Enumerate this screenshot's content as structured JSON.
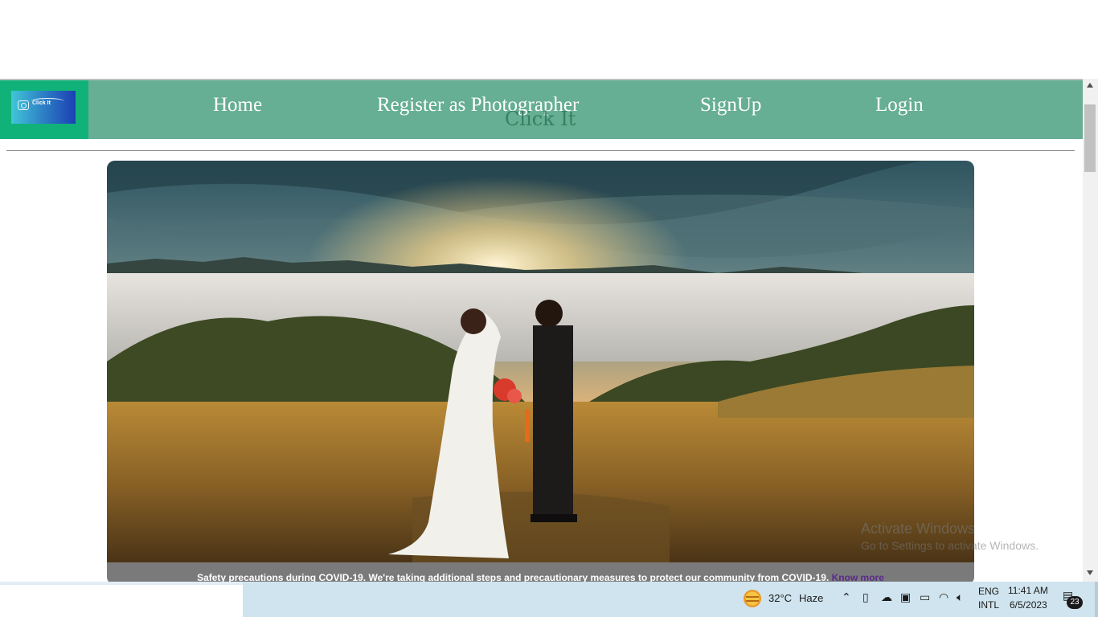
{
  "nav": {
    "logo_text": "Click It",
    "links": [
      "Home",
      "Register as Photographer",
      "SignUp",
      "Login"
    ]
  },
  "site_title": "Click It",
  "covid": {
    "message": "Safety precautions during COVID-19. We're taking additional steps and precautionary measures to protect our community from COVID-19.",
    "link": "Know more"
  },
  "watermark": {
    "line1": "Activate Windows",
    "line2": "Go to Settings to activate Windows."
  },
  "taskbar": {
    "temperature": "32°C",
    "weather": "Haze",
    "lang1": "ENG",
    "lang2": "INTL",
    "time": "11:41 AM",
    "date": "6/5/2023",
    "notifications": "23"
  },
  "colors": {
    "navbar": "#66ae94",
    "logo_box": "#11b27a",
    "link_visited": "#5b2a8c"
  }
}
